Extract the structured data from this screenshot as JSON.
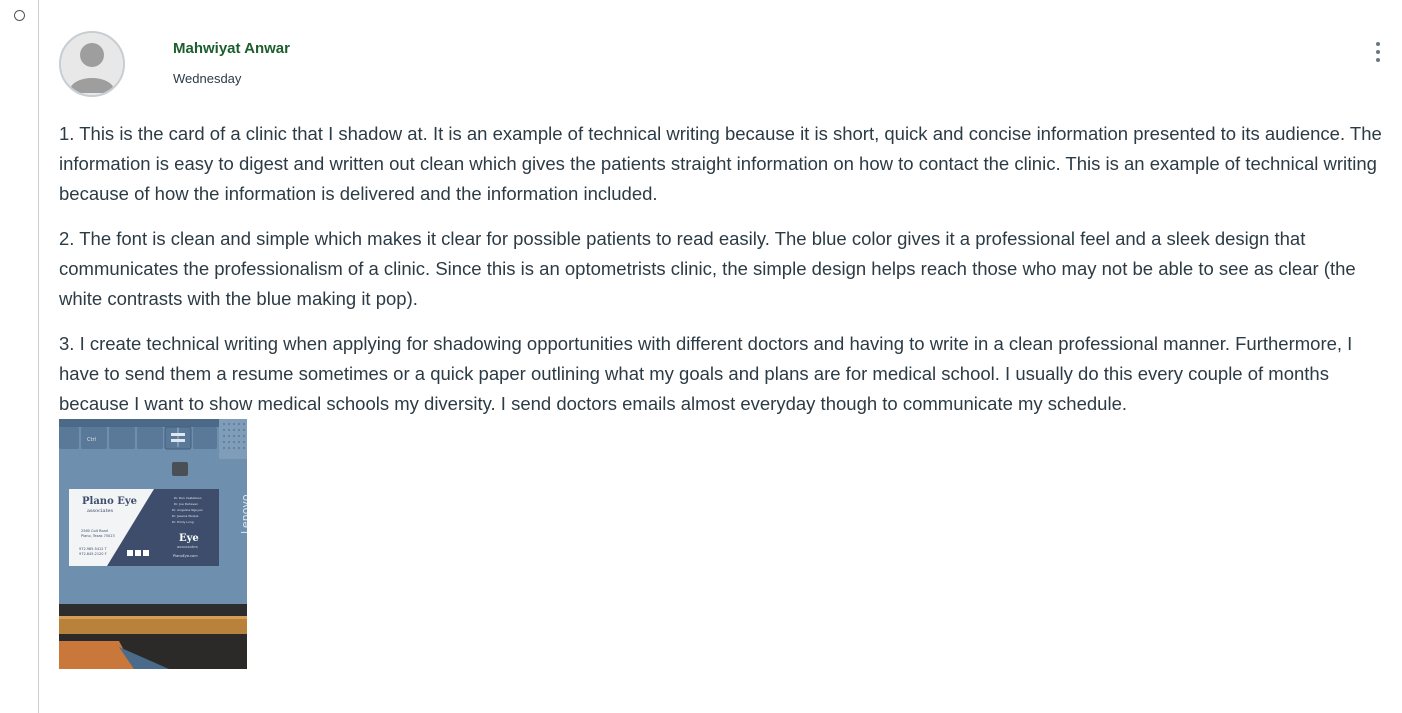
{
  "post": {
    "author": "Mahwiyat Anwar",
    "timestamp": "Wednesday",
    "paragraphs": [
      "1. This is the card of a clinic that I shadow at. It is an example of technical writing because it is short, quick and concise information presented to its audience. The information is easy to digest and written out clean which gives the patients straight information on how to contact the clinic. This is an example of technical writing because of how the information is delivered and the information included.",
      "2. The font is clean and simple which makes it clear for possible patients to read easily. The blue color gives it a professional feel and a sleek design that communicates the professionalism of a clinic. Since this is an optometrists clinic, the simple design helps reach those who may not be able to see as clear (the white contrasts with the blue making it pop).",
      "3. I create technical writing when applying for shadowing opportunities with different doctors and having to write in a clean professional manner. Furthermore, I have to send them a resume sometimes or a quick paper outlining what my goals and plans are for medical school. I usually do this every couple of months because I want to show medical schools my diversity. I send doctors emails almost everyday though to communicate my schedule."
    ]
  },
  "photo": {
    "card_logo_line1": "Plano Eye",
    "card_logo_line2": "associates",
    "card_address1": "2560 Coit Road",
    "card_address2": "Plano, Texas 75023",
    "card_phone1": "972.985.5412 T",
    "card_phone2": "972.845.2120 F",
    "card_doctors": [
      "Dr. Ron Castellano",
      "Dr. Joe Dehaven",
      "Dr. Angelina Nguyen",
      "Dr. Jessica Wulpia",
      "Dr. Emily Long"
    ],
    "card_logo_back": "Eye",
    "card_logo_back_sub": "associates",
    "card_website": "PlanoEye.com",
    "laptop_brand": "Lenovo",
    "key_ctrl": "Ctrl"
  },
  "colors": {
    "author": "#1d5e2e",
    "text": "#2d3b45",
    "thread_line": "#c7cdd1"
  },
  "icons": {
    "unread": "unread-dot-icon",
    "menu": "kebab-menu-icon",
    "avatar": "default-user-avatar-icon"
  }
}
